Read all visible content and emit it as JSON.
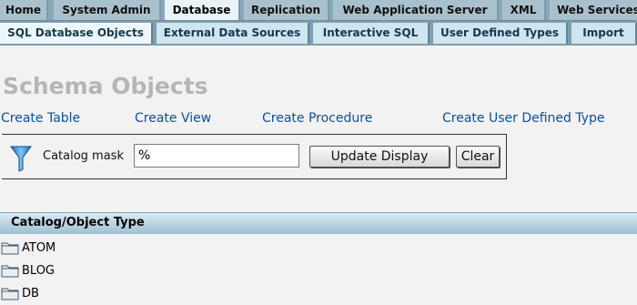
{
  "top_tabs": [
    "Home",
    "System Admin",
    "Database",
    "Replication",
    "Web Application Server",
    "XML",
    "Web Services"
  ],
  "top_tab_active": "Database",
  "sub_tabs": [
    "SQL Database Objects",
    "External Data Sources",
    "Interactive SQL",
    "User Defined Types",
    "Import"
  ],
  "sub_tab_active": "SQL Database Objects",
  "page_title": "Schema Objects",
  "links": [
    "Create Table",
    "Create View",
    "Create Procedure",
    "Create User Defined Type"
  ],
  "filter": {
    "label": "Catalog mask",
    "value": "%",
    "update_label": "Update Display",
    "clear_label": "Clear",
    "icon": "funnel-icon"
  },
  "table": {
    "header": "Catalog/Object Type",
    "rows": [
      "ATOM",
      "BLOG",
      "DB"
    ],
    "row_icon": "folder-icon"
  },
  "colors": {
    "link": "#0d4f9e",
    "title": "#b5b5b5",
    "tab_bar": "#8aa7b7"
  }
}
